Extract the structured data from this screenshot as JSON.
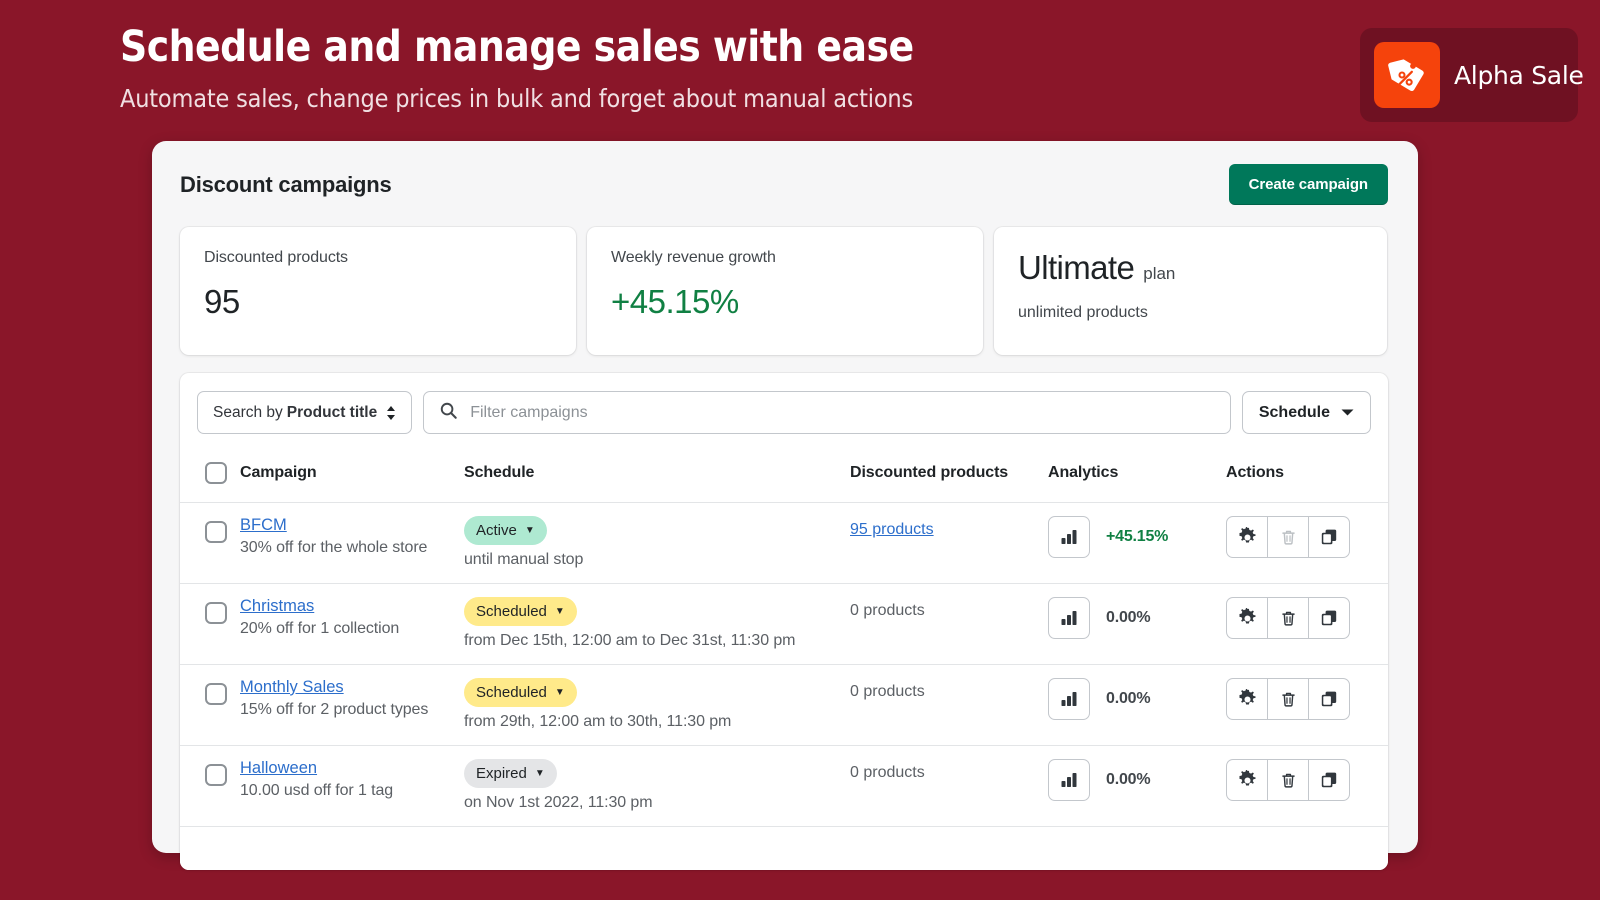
{
  "hero": {
    "title": "Schedule and manage sales with ease",
    "subtitle": "Automate sales, change prices in bulk and forget about manual actions"
  },
  "logo": {
    "name": "Alpha Sale",
    "mark_icon": "price-tag-percent-icon",
    "mark_color": "#f5430c",
    "badge_color": "#6f1122"
  },
  "theme": {
    "background": "#8a1629",
    "panel_background": "#f6f6f7",
    "primary_button": "#00785a",
    "link_color": "#2c6ecb",
    "success_green": "#108043"
  },
  "panel": {
    "title": "Discount campaigns",
    "create_button": "Create campaign"
  },
  "stats": [
    {
      "label": "Discounted products",
      "value": "95",
      "value_color": "default"
    },
    {
      "label": "Weekly revenue growth",
      "value": "+45.15%",
      "value_color": "green"
    }
  ],
  "plan_card": {
    "plan_name": "Ultimate",
    "plan_word": "plan",
    "plan_sub": "unlimited products"
  },
  "filters": {
    "search_by_prefix": "Search by",
    "search_by_field": "Product title",
    "search_by_icon": "up-down-chevron-icon",
    "search_icon": "search-icon",
    "filter_placeholder": "Filter campaigns",
    "filter_value": "",
    "schedule_label": "Schedule",
    "schedule_icon": "chevron-down-icon"
  },
  "table": {
    "columns": [
      "Campaign",
      "Schedule",
      "Discounted products",
      "Analytics",
      "Actions"
    ],
    "rows": [
      {
        "name": "BFCM",
        "description": "30% off for the whole store",
        "status": "Active",
        "status_style": "active",
        "schedule_when": "until manual stop",
        "discounted_products": "95 products",
        "discounted_is_link": true,
        "analytics_pct": "+45.15%",
        "analytics_pct_green": true,
        "delete_disabled": true
      },
      {
        "name": "Christmas",
        "description": "20% off for 1 collection",
        "status": "Scheduled",
        "status_style": "scheduled",
        "schedule_when": "from Dec 15th, 12:00 am to Dec 31st, 11:30 pm",
        "discounted_products": "0 products",
        "discounted_is_link": false,
        "analytics_pct": "0.00%",
        "analytics_pct_green": false,
        "delete_disabled": false
      },
      {
        "name": "Monthly Sales",
        "description": "15% off for 2 product types",
        "status": "Scheduled",
        "status_style": "scheduled",
        "schedule_when": "from 29th, 12:00 am to 30th, 11:30 pm",
        "discounted_products": "0 products",
        "discounted_is_link": false,
        "analytics_pct": "0.00%",
        "analytics_pct_green": false,
        "delete_disabled": false
      },
      {
        "name": "Halloween",
        "description": "10.00 usd off for 1 tag",
        "status": "Expired",
        "status_style": "expired",
        "schedule_when": "on Nov 1st 2022, 11:30 pm",
        "discounted_products": "0 products",
        "discounted_is_link": false,
        "analytics_pct": "0.00%",
        "analytics_pct_green": false,
        "delete_disabled": false
      }
    ],
    "row_icons": {
      "analytics": "bar-chart-icon",
      "settings": "gear-icon",
      "delete": "trash-icon",
      "duplicate": "duplicate-icon"
    }
  }
}
